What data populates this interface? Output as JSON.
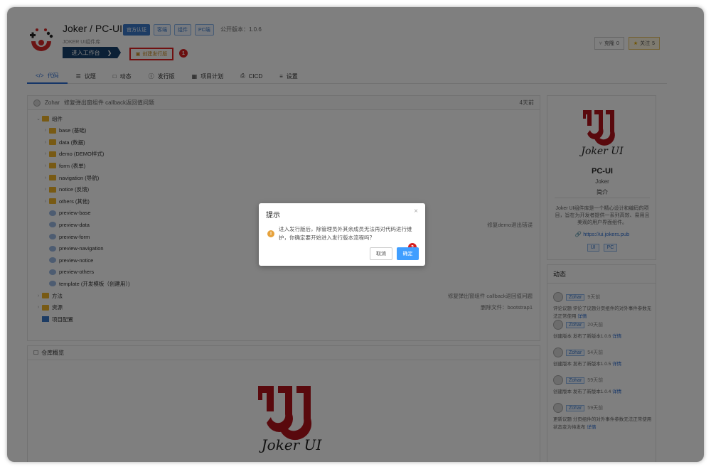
{
  "project": {
    "title": "Joker / PC-UI",
    "subtitle": "JOKER UI组件库",
    "badges": [
      "官方认证",
      "客端",
      "组件",
      "PC端"
    ],
    "public_version": "公开版本：1.0.6",
    "work_button": "进入工作台",
    "release_button": "创建发行版",
    "clone": "克隆",
    "clone_count": "0",
    "follow": "关注",
    "follow_count": "5"
  },
  "callouts": [
    "1",
    "2"
  ],
  "tabs": [
    {
      "label": "代码",
      "icon": "code-icon"
    },
    {
      "label": "议题",
      "icon": "list-icon"
    },
    {
      "label": "动态",
      "icon": "message-icon"
    },
    {
      "label": "发行版",
      "icon": "info-icon"
    },
    {
      "label": "项目计划",
      "icon": "calendar-icon"
    },
    {
      "label": "CICD",
      "icon": "printer-icon"
    },
    {
      "label": "设置",
      "icon": "settings-icon"
    }
  ],
  "commit": {
    "author": "Zohar",
    "message": "修复弹出窗组件 callback返回值问题",
    "time": "4天前"
  },
  "tree": [
    {
      "name": "组件",
      "type": "folder",
      "open": true,
      "level": 0,
      "msg": ""
    },
    {
      "name": "base (基础)",
      "type": "folder",
      "level": 1,
      "msg": ""
    },
    {
      "name": "data (数据)",
      "type": "folder",
      "level": 1,
      "msg": ""
    },
    {
      "name": "demo (DEMO样式)",
      "type": "folder",
      "level": 1,
      "msg": ""
    },
    {
      "name": "form (表单)",
      "type": "folder",
      "level": 1,
      "msg": ""
    },
    {
      "name": "navigation (导航)",
      "type": "folder",
      "level": 1,
      "msg": ""
    },
    {
      "name": "notice (反馈)",
      "type": "folder",
      "level": 1,
      "msg": ""
    },
    {
      "name": "others (其他)",
      "type": "folder",
      "level": 1,
      "msg": ""
    },
    {
      "name": "preview-base",
      "type": "file",
      "level": 1,
      "msg": ""
    },
    {
      "name": "preview-data",
      "type": "file",
      "level": 1,
      "msg": "修复demo退出错误"
    },
    {
      "name": "preview-form",
      "type": "file",
      "level": 1,
      "msg": ""
    },
    {
      "name": "preview-navigation",
      "type": "file",
      "level": 1,
      "msg": ""
    },
    {
      "name": "preview-notice",
      "type": "file",
      "level": 1,
      "msg": ""
    },
    {
      "name": "preview-others",
      "type": "file",
      "level": 1,
      "msg": ""
    },
    {
      "name": "template (开发模板（创建用）)",
      "type": "file",
      "level": 1,
      "msg": ""
    },
    {
      "name": "方法",
      "type": "folder",
      "level": 0,
      "msg": "修复弹出窗组件 callback返回值问题"
    },
    {
      "name": "资源",
      "type": "folder",
      "level": 0,
      "msg": "删除文件：bootstrap1"
    },
    {
      "name": "项目配置",
      "type": "config",
      "level": 0,
      "msg": ""
    }
  ],
  "overview": {
    "title": "仓库概览",
    "logo_text": "Joker UI"
  },
  "side": {
    "logo_text": "Joker UI",
    "name": "PC-UI",
    "author": "Joker",
    "intro_title": "简介",
    "description": "Joker UI组件库是一个精心设计和编码的项目，旨在为开发者提供一系列高效、易用且美观的用户界面组件。",
    "link": "https://ui.jokers.pub",
    "tags": [
      "UI",
      "PC"
    ]
  },
  "activity": {
    "title": "动态",
    "items": [
      {
        "user": "Zohar",
        "time": "9天前",
        "text": "评论议题 评论了议题分页组件的对外事件参数无法正常使用",
        "detail": "详情"
      },
      {
        "user": "Zohar",
        "time": "20天前",
        "text": "创建版本 发布了新版本1.0.6",
        "detail": "详情"
      },
      {
        "user": "Zohar",
        "time": "54天前",
        "text": "创建版本 发布了新版本1.0.5",
        "detail": "详情"
      },
      {
        "user": "Zohar",
        "time": "59天前",
        "text": "创建版本 发布了新版本1.0.4",
        "detail": "详情"
      },
      {
        "user": "Zohar",
        "time": "59天前",
        "text": "更新议题 分页组件的对外事件参数无法正常使用状态变为待发布",
        "detail": "详情"
      }
    ]
  },
  "dialog": {
    "title": "提示",
    "close": "×",
    "warn": "!",
    "message": "进入发行版后，除管理员外其余成员无法再对代码进行维护，你确定要开始进入发行版本流程吗？",
    "cancel": "取消",
    "ok": "确定"
  }
}
